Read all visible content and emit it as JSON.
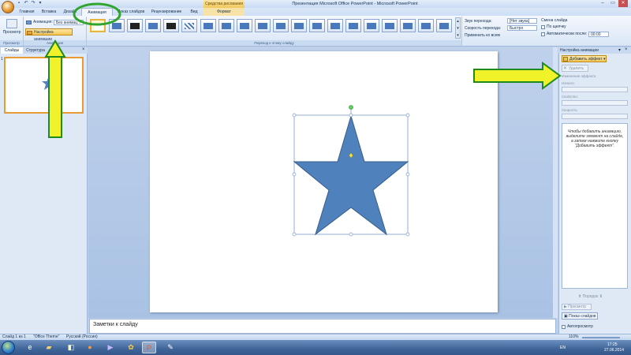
{
  "app": {
    "window_title": "Презентация Microsoft Office PowerPoint - Microsoft PowerPoint",
    "contextual_tab": "Средства рисования"
  },
  "tabs": [
    "Главная",
    "Вставка",
    "Дизайн",
    "Анимация",
    "Показ слайдов",
    "Рецензирование",
    "Вид",
    "Формат"
  ],
  "ribbon": {
    "preview_label": "Просмотр",
    "animation_label": "Анимация:",
    "animation_value": "Без анимац...",
    "custom_animation_label": "Настройка анимации",
    "group_preview": "Просмотр",
    "group_animation": "Анимация",
    "group_transition": "Переход к этому слайду",
    "sound_label": "Звук перехода:",
    "sound_value": "[Нет звука]",
    "speed_label": "Скорость перехода:",
    "speed_value": "Быстро",
    "apply_all_label": "Применить ко всем",
    "advance_title": "Смена слайда",
    "on_click_label": "По щелчку",
    "auto_after_label": "Автоматически после:",
    "auto_after_value": "00:00"
  },
  "left_pane": {
    "tab_slides": "Слайды",
    "tab_outline": "Структура",
    "slide_number": "1"
  },
  "notes": {
    "placeholder": "Заметки к слайду"
  },
  "task_pane": {
    "title": "Настройка анимации",
    "add_effect": "Добавить эффект",
    "remove": "Удалить",
    "change_label": "Изменение эффекта",
    "start_label": "Начало:",
    "property_label": "Свойство:",
    "speed_label": "Скорость:",
    "hint": "Чтобы добавить анимацию, выделите элемент на слайде, а затем нажмите кнопку \"Добавить эффект\".",
    "reorder_label": "Порядок",
    "play_label": "Просмотр",
    "slideshow_label": "Показ слайдов",
    "autopreview_label": "Автопросмотр"
  },
  "status_bar": {
    "slide_info": "Слайд 1 из 1",
    "theme": "\"Office Theme\"",
    "language": "Русский (Россия)",
    "zoom": "110%"
  },
  "taskbar": {
    "lang": "EN",
    "time": "17:25",
    "date": "27.06.2014"
  },
  "annotation_colors": {
    "arrow_fill": "#f2f22a",
    "arrow_border": "#1f8a1f",
    "circle": "#2fa52f"
  },
  "shape_colors": {
    "star_fill": "#4f81bd",
    "star_stroke": "#385d8a"
  }
}
